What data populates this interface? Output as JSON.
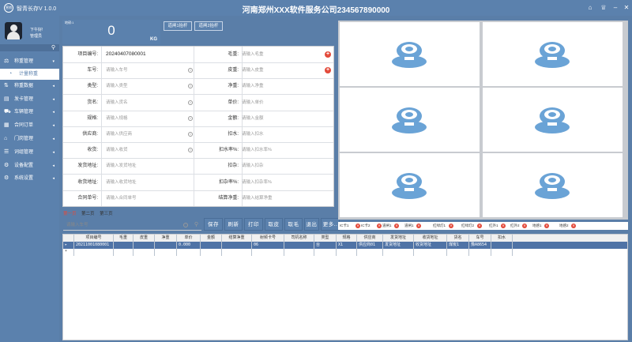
{
  "app": {
    "logo_text": "营销",
    "name": "智青长存V 1.0.0",
    "company": "河南郑州XXX软件服务公司234567890000",
    "window_buttons": [
      "home-icon",
      "shirt-icon",
      "minimize-icon",
      "close-icon"
    ]
  },
  "user": {
    "greeting": "下午好!",
    "role": "管理员"
  },
  "sidebar": {
    "items": [
      {
        "label": "称重管理",
        "icon": "scale-icon",
        "expanded": true
      },
      {
        "label": "计量称重",
        "icon": "sub-icon",
        "sub": true
      },
      {
        "label": "称重数据",
        "icon": "data-icon"
      },
      {
        "label": "发卡管理",
        "icon": "card-icon"
      },
      {
        "label": "车辆管理",
        "icon": "truck-icon"
      },
      {
        "label": "合同订单",
        "icon": "contract-icon"
      },
      {
        "label": "门岗管理",
        "icon": "gate-icon"
      },
      {
        "label": "词组管理",
        "icon": "words-icon"
      },
      {
        "label": "设备配置",
        "icon": "device-icon"
      },
      {
        "label": "系统设置",
        "icon": "gear-icon"
      }
    ]
  },
  "weight": {
    "label": "地磅:1",
    "value": "0",
    "unit": "KG"
  },
  "lift_buttons": [
    "道闸1抬杆",
    "道闸2抬杆"
  ],
  "form": {
    "rows": [
      [
        {
          "label": "项目编号:",
          "value": "20240407080001",
          "filled": true
        },
        {
          "label": "毛重:",
          "value": "请输入毛重",
          "plus": true
        }
      ],
      [
        {
          "label": "车号:",
          "value": "请输入车号",
          "clear": true
        },
        {
          "label": "皮重:",
          "value": "请输入皮重",
          "plus": true
        }
      ],
      [
        {
          "label": "类型:",
          "value": "请输入类型",
          "clear": true
        },
        {
          "label": "净重:",
          "value": "请输入净重"
        }
      ],
      [
        {
          "label": "货名:",
          "value": "请输入货名",
          "clear": true
        },
        {
          "label": "单价:",
          "value": "请输入单价"
        }
      ],
      [
        {
          "label": "规格:",
          "value": "请输入规格",
          "clear": true
        },
        {
          "label": "金额:",
          "value": "请输入金额"
        }
      ],
      [
        {
          "label": "供应商:",
          "value": "请输入供应商",
          "clear": true
        },
        {
          "label": "扣水:",
          "value": "请输入扣水"
        }
      ],
      [
        {
          "label": "收货:",
          "value": "请输入收货",
          "clear": true
        },
        {
          "label": "扣水率%:",
          "value": "请输入扣水率%"
        }
      ],
      [
        {
          "label": "发货地址:",
          "value": "请输入发货地址"
        },
        {
          "label": "扣杂:",
          "value": "请输入扣杂"
        }
      ],
      [
        {
          "label": "收货地址:",
          "value": "请输入收货地址"
        },
        {
          "label": "扣杂率%:",
          "value": "请输入扣杂率%"
        }
      ],
      [
        {
          "label": "合同单号:",
          "value": "请输入合同单号"
        },
        {
          "label": "结算净重:",
          "value": "请输入结算净重"
        }
      ]
    ]
  },
  "tabs": [
    "第一页",
    "第二页",
    "第三页"
  ],
  "search": {
    "placeholder": "请输入车号"
  },
  "actions": [
    "保存",
    "刷新",
    "打印",
    "取皮",
    "取毛",
    "退出",
    "更多.."
  ],
  "table": {
    "columns": [
      "项目编号",
      "毛重",
      "皮重",
      "净重",
      "单价",
      "金额",
      "结算净重",
      "射频卡号",
      "司机名称",
      "类型",
      "规格",
      "供应商",
      "发货地址",
      "收货地址",
      "货名",
      "车号",
      "扣水"
    ],
    "rows": [
      [
        "20211001080001",
        "",
        "",
        "",
        "0.000",
        "",
        "",
        "06",
        "",
        "台",
        "X1",
        "供应商01",
        "发货地址",
        "收货地址",
        "煤炭1",
        "豫A8654",
        ""
      ]
    ],
    "new_row_marker": "*",
    "selected_row_marker": "▸"
  },
  "cameras": 6,
  "sensors": [
    "IC卡1",
    "IC卡2",
    "道闸1",
    "道闸1",
    "红绿灯1",
    "红绿灯2",
    "红外1",
    "红外2",
    "地感1",
    "地感2"
  ],
  "colors": {
    "primary": "#5b81ad",
    "alert": "#e34a3a",
    "camera": "#6aa3d6"
  }
}
